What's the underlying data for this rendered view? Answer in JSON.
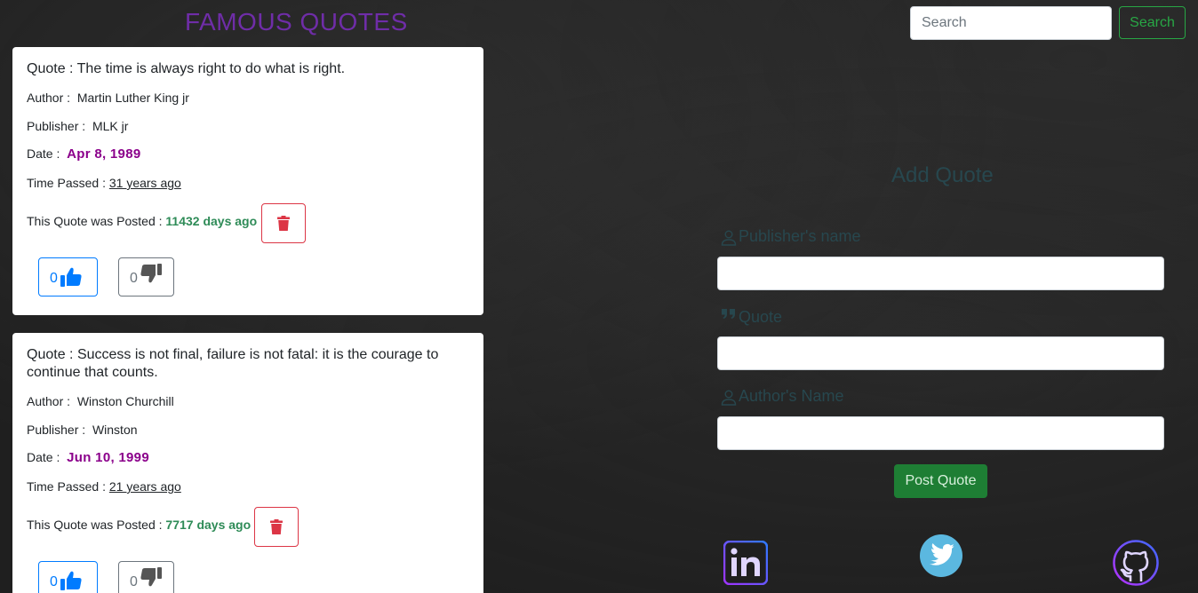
{
  "header": {
    "title": "FAMOUS QUOTES",
    "search_placeholder": "Search",
    "search_button": "Search"
  },
  "quotes": [
    {
      "quote_label": "Quote :",
      "quote": "The time is always right to do what is right.",
      "author_label": "Author :",
      "author": "Martin Luther King jr",
      "publisher_label": "Publisher :",
      "publisher": "MLK jr",
      "date_label": "Date :",
      "date": "Apr 8, 1989",
      "time_passed_label": "Time Passed :",
      "time_passed": "31 years ago",
      "posted_label": "This Quote was Posted :",
      "posted": "11432 days ago",
      "likes": "0",
      "dislikes": "0"
    },
    {
      "quote_label": "Quote :",
      "quote": "Success is not final, failure is not fatal: it is the courage to continue that counts.",
      "author_label": "Author :",
      "author": "Winston Churchill",
      "publisher_label": "Publisher :",
      "publisher": "Winston",
      "date_label": "Date :",
      "date": "Jun 10, 1999",
      "time_passed_label": "Time Passed :",
      "time_passed": "21 years ago",
      "posted_label": "This Quote was Posted :",
      "posted": "7717 days ago",
      "likes": "0",
      "dislikes": "0"
    }
  ],
  "form": {
    "title": "Add Quote",
    "publisher_label": "Publisher's name",
    "quote_label": "Quote",
    "author_label": "Author's Name",
    "post_button": "Post Quote"
  },
  "icons": {
    "linkedin": "linkedin-icon",
    "twitter": "twitter-icon",
    "github": "github-icon",
    "trash": "trash-icon",
    "like": "thumbs-up-icon",
    "dislike": "thumbs-down-icon",
    "person": "person-icon",
    "quote": "quote-icon"
  },
  "colors": {
    "title": "#6f2da8",
    "date": "#8b008b",
    "posted_days": "#2e8b57",
    "delete": "#dc3545",
    "like": "#007bff",
    "form_text": "#27474e",
    "post_button": "#1e7e34"
  }
}
